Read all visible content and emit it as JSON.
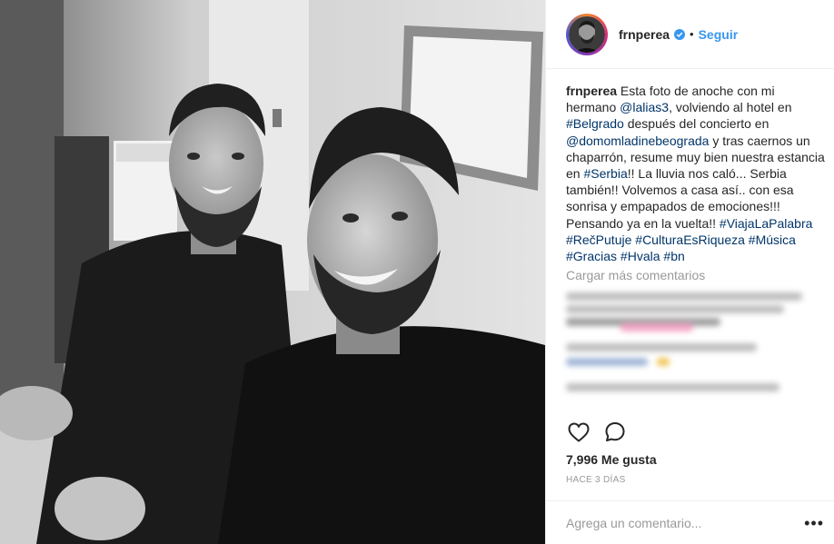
{
  "post": {
    "username": "frnperea",
    "follow_label": "Seguir",
    "separator": "•",
    "verified": true
  },
  "caption": {
    "username": "frnperea",
    "parts": [
      "Esta foto de anoche con mi hermano ",
      "@lalias3",
      ", volviendo al hotel en ",
      "#Belgrado",
      " después del concierto en ",
      "@domomladinebeograda",
      " y tras caernos un chaparrón, resume muy bien nuestra estancia en ",
      "#Serbia",
      "!! La lluvia nos caló... Serbia también!! Volvemos a casa así.. con esa sonrisa y empapados de emociones!!! Pensando ya en la vuelta!! ",
      "#ViajaLaPalabra",
      " ",
      "#RečPutuje",
      " ",
      "#CulturaEsRiqueza",
      " ",
      "#Música",
      " ",
      "#Gracias",
      " ",
      "#Hvala",
      " ",
      "#bn"
    ]
  },
  "comments": {
    "load_more_label": "Cargar más comentarios"
  },
  "actions": {
    "like_icon": "heart-outline",
    "comment_icon": "speech-bubble"
  },
  "stats": {
    "likes": "7,996 Me gusta",
    "timestamp": "HACE 3 DÍAS"
  },
  "comment_box": {
    "placeholder": "Agrega un comentario...",
    "more_label": "•••"
  },
  "colors": {
    "link": "#003569",
    "follow": "#3897f0",
    "muted": "#999999",
    "text": "#262626"
  }
}
